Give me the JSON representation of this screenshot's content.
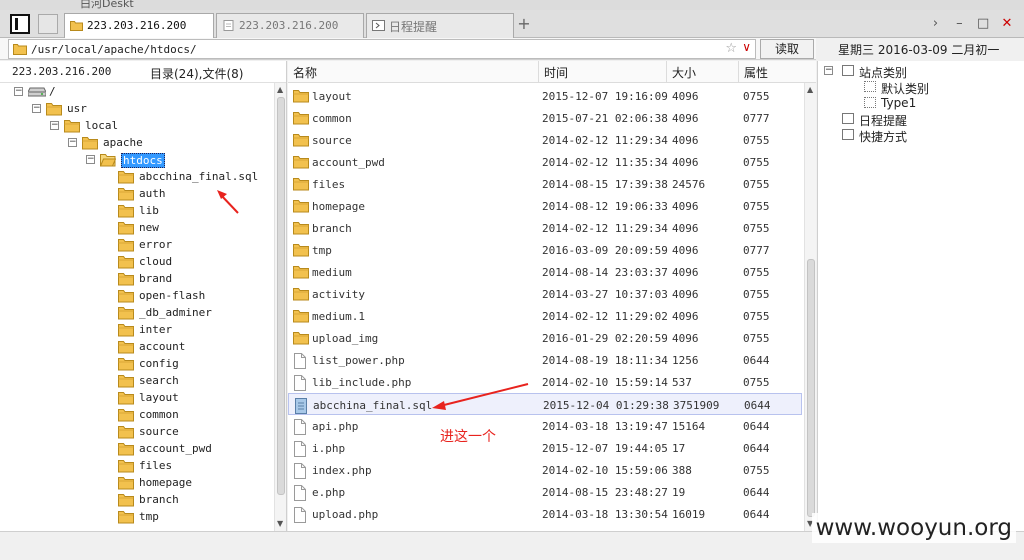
{
  "desktop": {
    "partial_text": "白河Deskt"
  },
  "tabs": [
    {
      "label": "223.203.216.200",
      "active": true,
      "icon": "folder-icon"
    },
    {
      "label": "223.203.216.200",
      "active": false,
      "icon": "document-icon"
    },
    {
      "label": "日程提醒",
      "active": false,
      "icon": "calendar-icon"
    }
  ],
  "tab_add_label": "+",
  "window_controls": {
    "nav": "›",
    "minimize": "–",
    "maximize": "□",
    "close": "✕"
  },
  "path": {
    "value": "/usr/local/apache/htdocs/",
    "star": "☆",
    "dropdown": "∨"
  },
  "read_button": "读取",
  "date_display": "星期三  2016-03-09  二月初一",
  "tree": {
    "host": "223.203.216.200",
    "counts": "目录(24),文件(8)",
    "nodes": [
      {
        "label": "/",
        "level": 0,
        "expander": "−",
        "icon": "drive-icon"
      },
      {
        "label": "usr",
        "level": 1,
        "expander": "−",
        "icon": "folder-icon"
      },
      {
        "label": "local",
        "level": 2,
        "expander": "−",
        "icon": "folder-icon"
      },
      {
        "label": "apache",
        "level": 3,
        "expander": "−",
        "icon": "folder-icon"
      },
      {
        "label": "htdocs",
        "level": 4,
        "expander": "−",
        "icon": "open-folder-icon",
        "selected": true
      },
      {
        "label": "abcchina_final.sql",
        "level": 5,
        "icon": "folder-icon"
      },
      {
        "label": "auth",
        "level": 5,
        "icon": "folder-icon"
      },
      {
        "label": "lib",
        "level": 5,
        "icon": "folder-icon"
      },
      {
        "label": "new",
        "level": 5,
        "icon": "folder-icon"
      },
      {
        "label": "error",
        "level": 5,
        "icon": "folder-icon"
      },
      {
        "label": "cloud",
        "level": 5,
        "icon": "folder-icon"
      },
      {
        "label": "brand",
        "level": 5,
        "icon": "folder-icon"
      },
      {
        "label": "open-flash",
        "level": 5,
        "icon": "folder-icon"
      },
      {
        "label": "_db_adminer",
        "level": 5,
        "icon": "folder-icon"
      },
      {
        "label": "inter",
        "level": 5,
        "icon": "folder-icon"
      },
      {
        "label": "account",
        "level": 5,
        "icon": "folder-icon"
      },
      {
        "label": "config",
        "level": 5,
        "icon": "folder-icon"
      },
      {
        "label": "search",
        "level": 5,
        "icon": "folder-icon"
      },
      {
        "label": "layout",
        "level": 5,
        "icon": "folder-icon"
      },
      {
        "label": "common",
        "level": 5,
        "icon": "folder-icon"
      },
      {
        "label": "source",
        "level": 5,
        "icon": "folder-icon"
      },
      {
        "label": "account_pwd",
        "level": 5,
        "icon": "folder-icon"
      },
      {
        "label": "files",
        "level": 5,
        "icon": "folder-icon"
      },
      {
        "label": "homepage",
        "level": 5,
        "icon": "folder-icon"
      },
      {
        "label": "branch",
        "level": 5,
        "icon": "folder-icon"
      },
      {
        "label": "tmp",
        "level": 5,
        "icon": "folder-icon"
      }
    ]
  },
  "list": {
    "columns": {
      "name": "名称",
      "time": "时间",
      "size": "大小",
      "perm": "属性"
    },
    "rows": [
      {
        "name": "layout",
        "time": "2015-12-07 19:16:09",
        "size": "4096",
        "perm": "0755",
        "type": "folder"
      },
      {
        "name": "common",
        "time": "2015-07-21 02:06:38",
        "size": "4096",
        "perm": "0777",
        "type": "folder"
      },
      {
        "name": "source",
        "time": "2014-02-12 11:29:34",
        "size": "4096",
        "perm": "0755",
        "type": "folder"
      },
      {
        "name": "account_pwd",
        "time": "2014-02-12 11:35:34",
        "size": "4096",
        "perm": "0755",
        "type": "folder"
      },
      {
        "name": "files",
        "time": "2014-08-15 17:39:38",
        "size": "24576",
        "perm": "0755",
        "type": "folder"
      },
      {
        "name": "homepage",
        "time": "2014-08-12 19:06:33",
        "size": "4096",
        "perm": "0755",
        "type": "folder"
      },
      {
        "name": "branch",
        "time": "2014-02-12 11:29:34",
        "size": "4096",
        "perm": "0755",
        "type": "folder"
      },
      {
        "name": "tmp",
        "time": "2016-03-09 20:09:59",
        "size": "4096",
        "perm": "0777",
        "type": "folder"
      },
      {
        "name": "medium",
        "time": "2014-08-14 23:03:37",
        "size": "4096",
        "perm": "0755",
        "type": "folder"
      },
      {
        "name": "activity",
        "time": "2014-03-27 10:37:03",
        "size": "4096",
        "perm": "0755",
        "type": "folder"
      },
      {
        "name": "medium.1",
        "time": "2014-02-12 11:29:02",
        "size": "4096",
        "perm": "0755",
        "type": "folder"
      },
      {
        "name": "upload_img",
        "time": "2016-01-29 02:20:59",
        "size": "4096",
        "perm": "0755",
        "type": "folder"
      },
      {
        "name": "list_power.php",
        "time": "2014-08-19 18:11:34",
        "size": "1256",
        "perm": "0644",
        "type": "file"
      },
      {
        "name": "lib_include.php",
        "time": "2014-02-10 15:59:14",
        "size": "537",
        "perm": "0755",
        "type": "file"
      },
      {
        "name": "abcchina_final.sql",
        "time": "2015-12-04 01:29:38",
        "size": "3751909",
        "perm": "0644",
        "type": "sqlfile",
        "selected": true
      },
      {
        "name": "api.php",
        "time": "2014-03-18 13:19:47",
        "size": "15164",
        "perm": "0644",
        "type": "file"
      },
      {
        "name": "i.php",
        "time": "2015-12-07 19:44:05",
        "size": "17",
        "perm": "0644",
        "type": "file"
      },
      {
        "name": "index.php",
        "time": "2014-02-10 15:59:06",
        "size": "388",
        "perm": "0755",
        "type": "file"
      },
      {
        "name": "e.php",
        "time": "2014-08-15 23:48:27",
        "size": "19",
        "perm": "0644",
        "type": "file"
      },
      {
        "name": "upload.php",
        "time": "2014-03-18 13:30:54",
        "size": "16019",
        "perm": "0644",
        "type": "file"
      }
    ]
  },
  "side_tree": [
    {
      "label": "站点类别",
      "level": 0,
      "expander": "−",
      "icon": "category-icon"
    },
    {
      "label": "默认类别",
      "level": 1,
      "icon": "category-item-icon"
    },
    {
      "label": "Type1",
      "level": 1,
      "icon": "category-item-icon"
    },
    {
      "label": "日程提醒",
      "level": 0,
      "icon": "calendar-icon"
    },
    {
      "label": "快捷方式",
      "level": 0,
      "icon": "shortcut-icon"
    }
  ],
  "annotation": {
    "text": "进这一个",
    "color": "#e8231e"
  },
  "watermark": "www.wooyun.org",
  "colors": {
    "selection": "#3399ff",
    "folder": "#f2c14e",
    "annotation": "#e8231e"
  }
}
